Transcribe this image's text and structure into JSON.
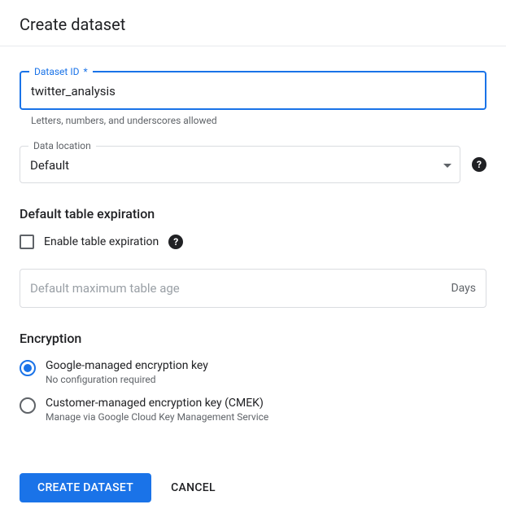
{
  "header": {
    "title": "Create dataset"
  },
  "datasetId": {
    "label": "Dataset ID",
    "required_mark": "*",
    "value": "twitter_analysis",
    "helper": "Letters, numbers, and underscores allowed"
  },
  "dataLocation": {
    "label": "Data location",
    "value": "Default"
  },
  "expiration": {
    "section_title": "Default table expiration",
    "checkbox_label": "Enable table expiration",
    "input_placeholder": "Default maximum table age",
    "input_suffix": "Days"
  },
  "encryption": {
    "section_title": "Encryption",
    "options": [
      {
        "label": "Google-managed encryption key",
        "description": "No configuration required",
        "selected": true
      },
      {
        "label": "Customer-managed encryption key (CMEK)",
        "description": "Manage via Google Cloud Key Management Service",
        "selected": false
      }
    ]
  },
  "actions": {
    "primary": "CREATE DATASET",
    "cancel": "CANCEL"
  }
}
